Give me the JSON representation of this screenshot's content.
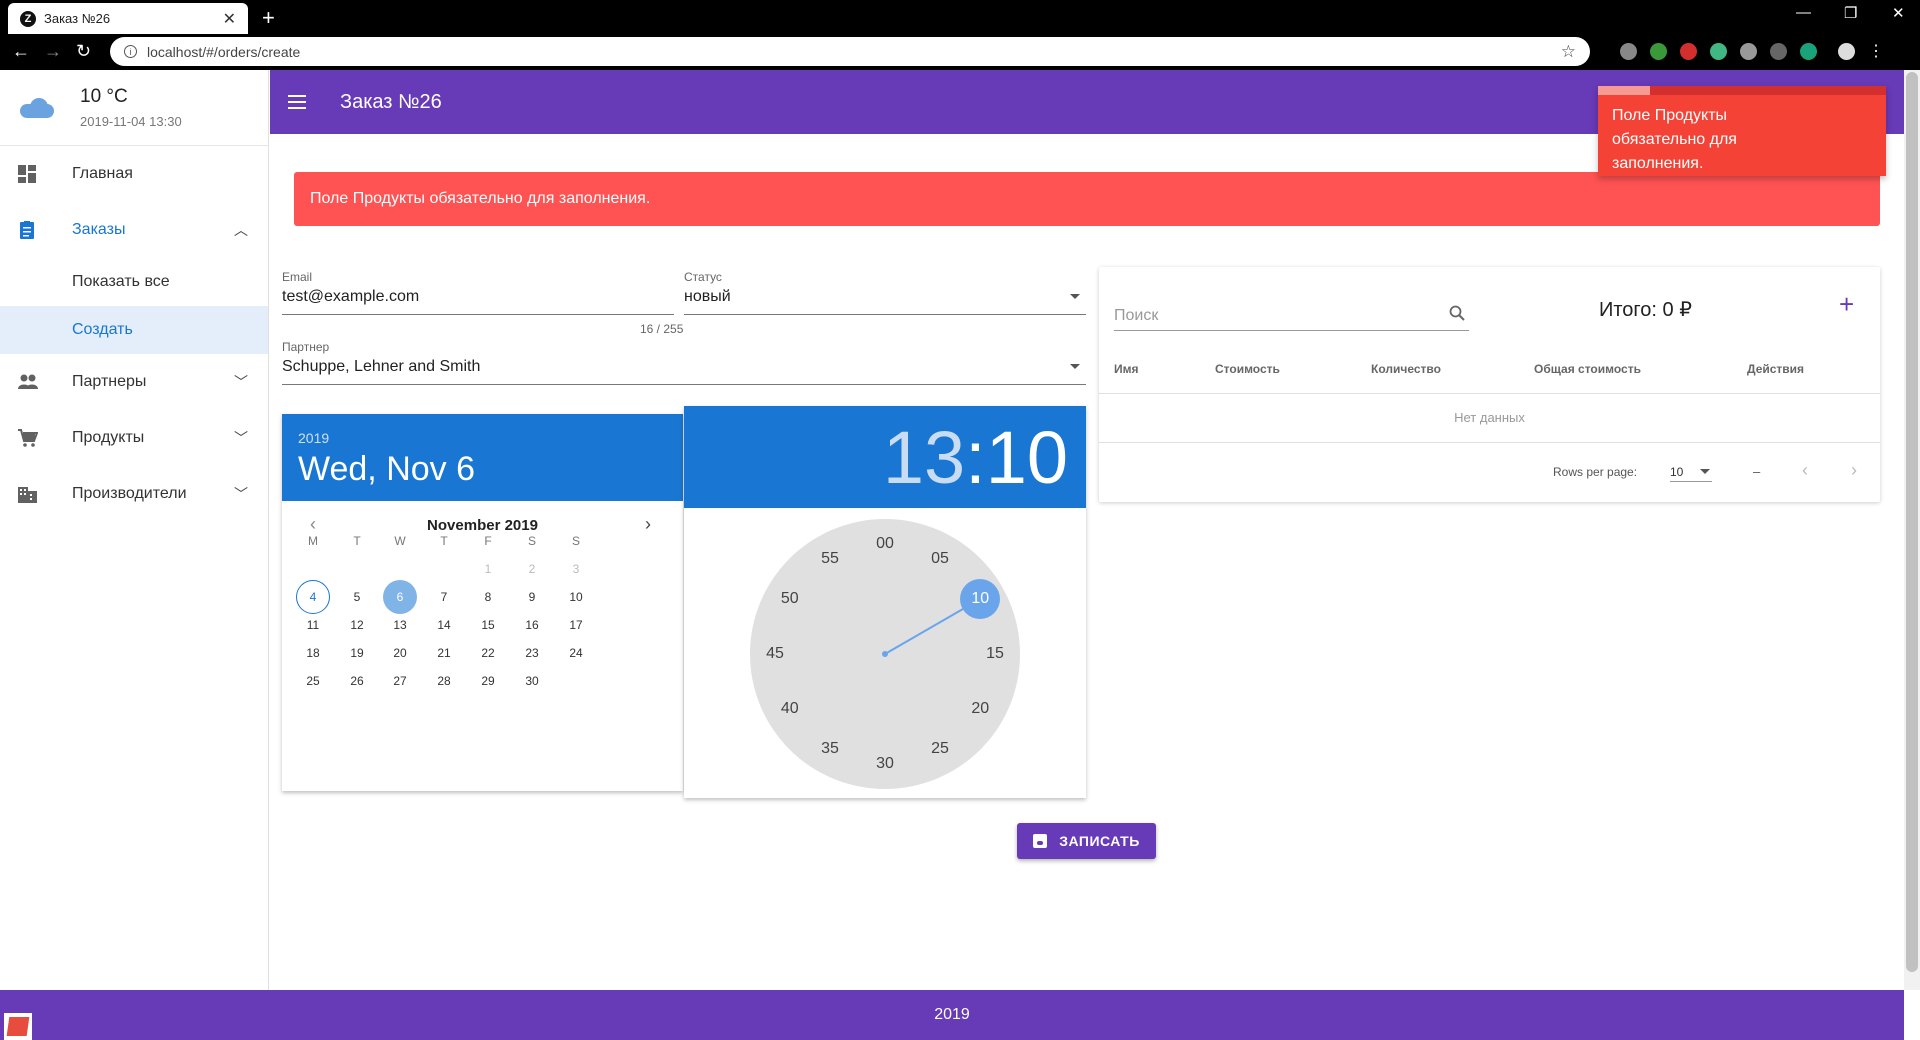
{
  "browser": {
    "tab_title": "Заказ №26",
    "url": "localhost/#/orders/create"
  },
  "weather": {
    "temp": "10 °C",
    "datetime": "2019-11-04 13:30"
  },
  "sidebar": {
    "items": [
      {
        "label": "Главная",
        "icon": "dashboard-icon"
      },
      {
        "label": "Заказы",
        "icon": "clipboard-icon"
      },
      {
        "label": "Показать все"
      },
      {
        "label": "Создать"
      },
      {
        "label": "Партнеры",
        "icon": "people-icon"
      },
      {
        "label": "Продукты",
        "icon": "cart-icon"
      },
      {
        "label": "Производители",
        "icon": "building-icon"
      }
    ]
  },
  "appbar": {
    "title": "Заказ №26"
  },
  "errors": {
    "banner": "Поле Продукты обязательно для заполнения.",
    "toast": "Поле Продукты обязательно для заполнения."
  },
  "form": {
    "email_label": "Email",
    "email_value": "test@example.com",
    "email_counter": "16 / 255",
    "status_label": "Статус",
    "status_value": "новый",
    "partner_label": "Партнер",
    "partner_value": "Schuppe, Lehner and Smith"
  },
  "datepicker": {
    "year": "2019",
    "date": "Wed, Nov 6",
    "month": "November 2019",
    "weekdays": [
      "M",
      "T",
      "W",
      "T",
      "F",
      "S",
      "S"
    ],
    "weeks": [
      [
        "",
        "",
        "",
        "",
        "1",
        "2",
        "3"
      ],
      [
        "4",
        "5",
        "6",
        "7",
        "8",
        "9",
        "10"
      ],
      [
        "11",
        "12",
        "13",
        "14",
        "15",
        "16",
        "17"
      ],
      [
        "18",
        "19",
        "20",
        "21",
        "22",
        "23",
        "24"
      ],
      [
        "25",
        "26",
        "27",
        "28",
        "29",
        "30",
        ""
      ]
    ],
    "today": "4",
    "selected": "6",
    "disabled": [
      "1",
      "2",
      "3"
    ]
  },
  "timepicker": {
    "hour": "13",
    "sep": ":",
    "minute": "10",
    "clock_numbers": [
      "00",
      "05",
      "10",
      "15",
      "20",
      "25",
      "30",
      "35",
      "40",
      "45",
      "50",
      "55"
    ],
    "selected_minute": "10"
  },
  "table": {
    "search_placeholder": "Поиск",
    "total": "Итого: 0 ₽",
    "headers": [
      "Имя",
      "Стоимость",
      "Количество",
      "Общая стоимость",
      "Действия"
    ],
    "no_data": "Нет данных",
    "rows_per_page_label": "Rows per page:",
    "rows_per_page": "10",
    "range": "–"
  },
  "save_label": "ЗАПИСАТЬ",
  "footer": {
    "year": "2019"
  },
  "colors": {
    "primary": "#673ab7",
    "picker_blue": "#1976d2",
    "error": "#ff5252",
    "toast": "#f44336"
  }
}
